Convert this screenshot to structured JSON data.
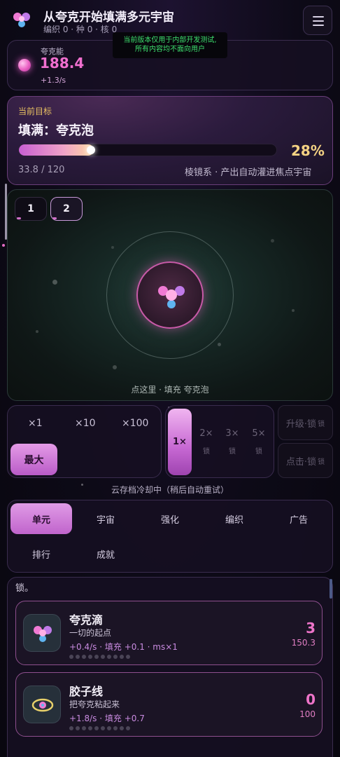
{
  "header": {
    "title": "从夸克开始填满多元宇宙",
    "subtitle": "编织 0 · 种 0 · 核 0",
    "notice_line1": "当前版本仅用于内部开发测试,",
    "notice_line2": "所有内容均不面向用户"
  },
  "energy": {
    "label": "夸克能",
    "value": "188.4",
    "rate": "+1.3/s"
  },
  "goal": {
    "label": "当前目标",
    "title": "填满：夸克泡",
    "progress": 0.28,
    "percent": "28%",
    "count": "33.8 / 120",
    "note": "棱镜系 · 产出自动灌进焦点宇宙"
  },
  "scene": {
    "tabs": [
      "1",
      "2"
    ],
    "caption": "点这里 · 填充 夸克泡"
  },
  "multipliers": {
    "options": [
      "×1",
      "×10",
      "×100"
    ],
    "max_label": "最大"
  },
  "speed": {
    "active": "1×",
    "options": [
      {
        "label": "2×",
        "lock": "锁"
      },
      {
        "label": "3×",
        "lock": "锁"
      },
      {
        "label": "5×",
        "lock": "锁"
      }
    ]
  },
  "side_buttons": {
    "upgrade": "升级·锁",
    "upgrade_lock": "锁",
    "click": "点击·锁",
    "click_lock": "锁"
  },
  "cloud_note": "云存档冷却中（稍后自动重试）",
  "nav": {
    "items": [
      "单元",
      "宇宙",
      "强化",
      "编织",
      "广告",
      "排行",
      "成就"
    ]
  },
  "list": {
    "head": "锁。",
    "units": [
      {
        "name": "夸克滴",
        "desc": "一切的起点",
        "stats": "+0.4/s · 填充 +0.1 · ms×1",
        "count": "3",
        "cost": "150.3"
      },
      {
        "name": "胶子线",
        "desc": "把夸克粘起来",
        "stats": "+1.8/s · 填充 +0.7",
        "count": "0",
        "cost": "100"
      }
    ]
  },
  "colors": {
    "accent_pink": "#ee74c9",
    "accent_gold": "#f4d283",
    "notice_green": "#3ddf6e"
  }
}
